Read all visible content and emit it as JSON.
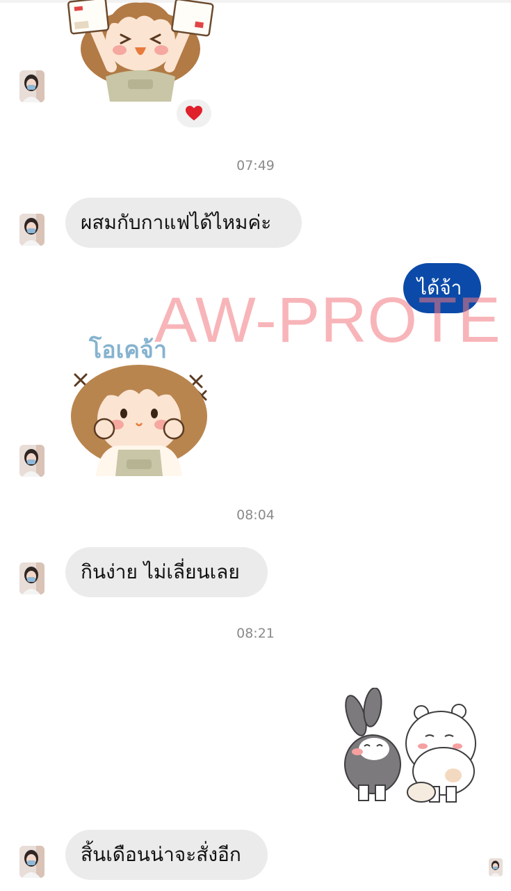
{
  "messages": {
    "m1_text": "ผสมกับกาแฟได้ไหมค่ะ",
    "m2_text": "ได้จ้า",
    "m3_text": "กินง่าย ไม่เลี่ยนเลย",
    "m4_text": "สิ้นเดือนน่าจะสั่งอีก"
  },
  "timestamps": {
    "t1": "07:49",
    "t2": "08:04",
    "t3": "08:21"
  },
  "sticker_okay_text": "โอเคจ้า",
  "reaction_icon": "heart-icon",
  "watermark_text": "AW-PROTE",
  "colors": {
    "outgoing_bubble": "#0b4aa8",
    "incoming_bubble": "#ebebeb",
    "timestamp": "#8a8a8a",
    "watermark": "#f27880",
    "reaction_heart": "#e0202a"
  }
}
